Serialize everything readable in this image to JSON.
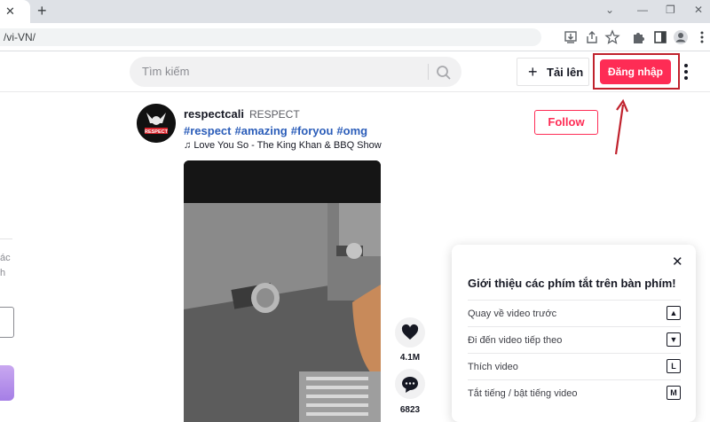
{
  "browser": {
    "tab_close": "✕",
    "new_tab": "+",
    "address_url": "/vi-VN/",
    "win_controls": [
      "⌄",
      "—",
      "❐",
      "✕"
    ]
  },
  "header": {
    "search_placeholder": "Tìm kiếm",
    "upload_label": "Tải lên",
    "login_label": "Đăng nhập"
  },
  "sidebar": {
    "fragments": [
      "ác",
      "h"
    ]
  },
  "post": {
    "avatar_text": "RESPECT",
    "username": "respectcali",
    "nickname": "RESPECT",
    "hashtags": [
      "#respect",
      "#amazing",
      "#foryou",
      "#omg"
    ],
    "music": "Love You So - The King Khan & BBQ Show",
    "follow_label": "Follow",
    "like_count": "4.1M",
    "comment_count": "6823"
  },
  "shortcuts": {
    "title": "Giới thiệu các phím tắt trên bàn phím!",
    "items": [
      {
        "label": "Quay về video trước",
        "key": "▲"
      },
      {
        "label": "Đi đến video tiếp theo",
        "key": "▼"
      },
      {
        "label": "Thích video",
        "key": "L"
      },
      {
        "label": "Tắt tiếng / bật tiếng video",
        "key": "M"
      }
    ]
  },
  "colors": {
    "accent": "#fe2c55",
    "hashtag": "#2b5db9",
    "annotation": "#c0222d"
  }
}
